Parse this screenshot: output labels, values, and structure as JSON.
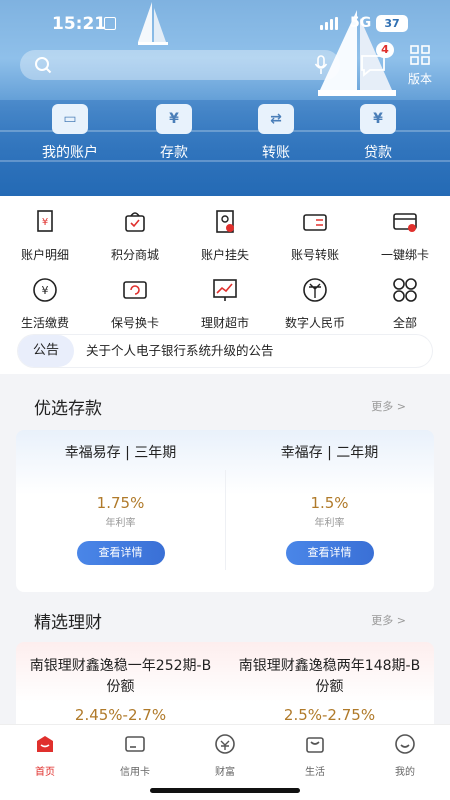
{
  "status_bar": {
    "time": "15:21",
    "network": "5G",
    "battery": "37"
  },
  "search": {
    "placeholder": ""
  },
  "header": {
    "message_badge": "4",
    "message_label": "消息",
    "version_label": "版本"
  },
  "quick_actions": [
    {
      "label": "我的账户",
      "icon": "wallet-icon"
    },
    {
      "label": "存款",
      "icon": "deposit-icon"
    },
    {
      "label": "转账",
      "icon": "transfer-icon"
    },
    {
      "label": "贷款",
      "icon": "loan-icon"
    }
  ],
  "services": [
    {
      "label": "账户明细",
      "icon": "account-detail-icon"
    },
    {
      "label": "积分商城",
      "icon": "points-mall-icon"
    },
    {
      "label": "账户挂失",
      "icon": "report-loss-icon"
    },
    {
      "label": "账号转账",
      "icon": "account-transfer-icon"
    },
    {
      "label": "一键绑卡",
      "icon": "bind-card-icon"
    },
    {
      "label": "生活缴费",
      "icon": "bill-pay-icon"
    },
    {
      "label": "保号换卡",
      "icon": "card-replace-icon"
    },
    {
      "label": "理财超市",
      "icon": "wealth-market-icon"
    },
    {
      "label": "数字人民币",
      "icon": "digital-rmb-icon"
    },
    {
      "label": "全部",
      "icon": "all-icon"
    }
  ],
  "notice": {
    "tag": "公告",
    "text": "关于个人电子银行系统升级的公告"
  },
  "deposits": {
    "title": "优选存款",
    "more": "更多 >",
    "items": [
      {
        "name": "幸福易存 | 三年期",
        "rate": "1.75%",
        "rate_label": "年利率",
        "button": "查看详情"
      },
      {
        "name": "幸福存 | 二年期",
        "rate": "1.5%",
        "rate_label": "年利率",
        "button": "查看详情"
      }
    ]
  },
  "wealth": {
    "title": "精选理财",
    "more": "更多 >",
    "items": [
      {
        "name": "南银理财鑫逸稳一年252期-B份额",
        "rate": "2.45%-2.7%"
      },
      {
        "name": "南银理财鑫逸稳两年148期-B份额",
        "rate": "2.5%-2.75%"
      }
    ]
  },
  "tabbar": [
    {
      "label": "首页",
      "active": true
    },
    {
      "label": "信用卡",
      "active": false
    },
    {
      "label": "财富",
      "active": false
    },
    {
      "label": "生活",
      "active": false
    },
    {
      "label": "我的",
      "active": false
    }
  ],
  "colors": {
    "accent": "#e0302d",
    "primary_blue": "#3a70d6",
    "rate_gold": "#b07a2a"
  }
}
